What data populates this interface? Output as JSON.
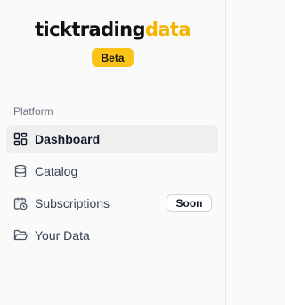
{
  "logo": {
    "part1": "ticktrading",
    "part2": "data"
  },
  "badge": {
    "label": "Beta"
  },
  "section": {
    "label": "Platform"
  },
  "nav": {
    "items": [
      {
        "label": "Dashboard",
        "icon": "dashboard-icon",
        "active": true
      },
      {
        "label": "Catalog",
        "icon": "database-icon"
      },
      {
        "label": "Subscriptions",
        "icon": "calendar-clock-icon",
        "badge": "Soon"
      },
      {
        "label": "Your Data",
        "icon": "folder-open-icon"
      }
    ]
  },
  "colors": {
    "brand_accent": "#f4b400",
    "badge_bg": "#fcc419",
    "active_bg": "#efefef"
  }
}
